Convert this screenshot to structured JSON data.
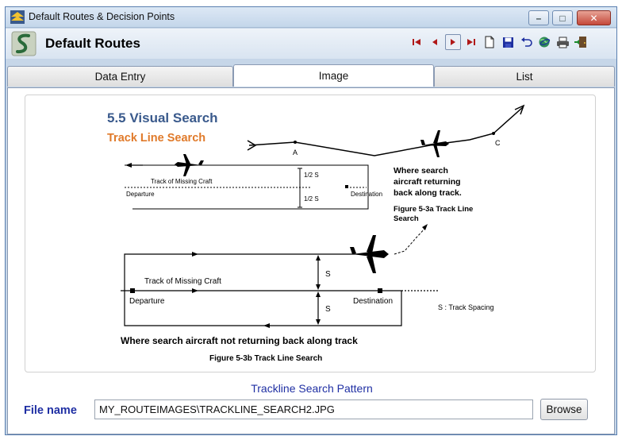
{
  "window": {
    "title": "Default Routes & Decision Points"
  },
  "window_controls": {
    "minimize": "–",
    "maximize": "□",
    "close": "✕"
  },
  "header": {
    "title": "Default Routes"
  },
  "toolbar": {
    "icons": [
      "first-record-icon",
      "previous-record-icon",
      "next-record-icon",
      "last-record-icon",
      "new-record-icon",
      "save-icon",
      "undo-icon",
      "web-icon",
      "print-icon",
      "exit-icon"
    ]
  },
  "tabs": [
    {
      "label": "Data Entry",
      "active": false
    },
    {
      "label": "Image",
      "active": true
    },
    {
      "label": "List",
      "active": false
    }
  ],
  "image": {
    "heading": "5.5 Visual Search",
    "subheading": "Track Line Search",
    "fig_a": {
      "track_label": "Track of Missing Craft",
      "departure": "Departure",
      "destination": "Destination",
      "half_s_top": "1/2 S",
      "half_s_bottom": "1/2 S",
      "point_a": "A",
      "point_c": "C",
      "note_line1": "Where search",
      "note_line2": "aircraft returning",
      "note_line3": "back along track.",
      "caption_line1": "Figure 5-3a Track Line",
      "caption_line2": "Search"
    },
    "fig_b": {
      "track_label": "Track of Missing Craft",
      "departure": "Departure",
      "destination": "Destination",
      "s_top": "S",
      "s_bottom": "S",
      "legend": "S : Track Spacing",
      "note": "Where search aircraft not returning back along track",
      "caption": "Figure 5-3b Track Line Search"
    },
    "colors": {
      "heading": "#3a5a8c",
      "subheading": "#e07a2a"
    }
  },
  "caption": "Trackline Search Pattern",
  "file": {
    "label": "File name",
    "value": "MY_ROUTEIMAGES\\TRACKLINE_SEARCH2.JPG",
    "browse_label": "Browse"
  }
}
